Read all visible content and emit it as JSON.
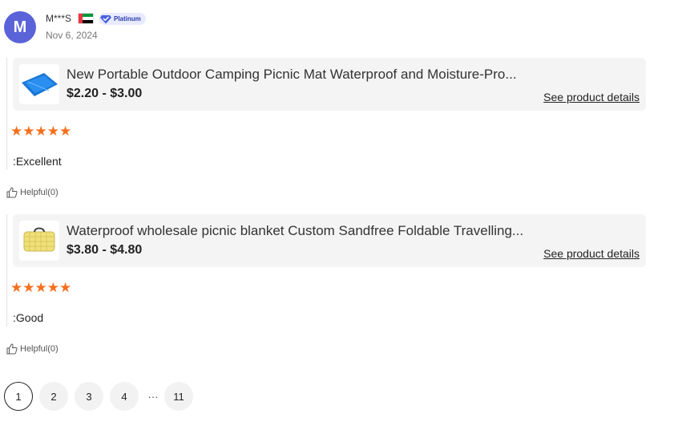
{
  "reviewer": {
    "avatar_letter": "M",
    "name": "M***S",
    "badge": "Platinum",
    "date": "Nov 6, 2024"
  },
  "reviews": [
    {
      "product_title": "New Portable Outdoor Camping Picnic Mat Waterproof and Moisture-Pro...",
      "price": "$2.20 - $3.00",
      "link": "See product details",
      "rating": 5,
      "stars": "★★★★★",
      "text": ":Excellent",
      "helpful": "Helpful(0)"
    },
    {
      "product_title": "Waterproof wholesale picnic blanket Custom Sandfree Foldable Travelling...",
      "price": "$3.80 - $4.80",
      "link": "See product details",
      "rating": 5,
      "stars": "★★★★★",
      "text": ":Good",
      "helpful": "Helpful(0)"
    }
  ],
  "pagination": {
    "pages": [
      "1",
      "2",
      "3",
      "4"
    ],
    "ellipsis": "···",
    "last": "11",
    "current": "1"
  },
  "colors": {
    "avatar": "#5a63d8",
    "star": "#f4701d",
    "card": "#f4f4f4",
    "badge_bg": "#e8ebff"
  }
}
